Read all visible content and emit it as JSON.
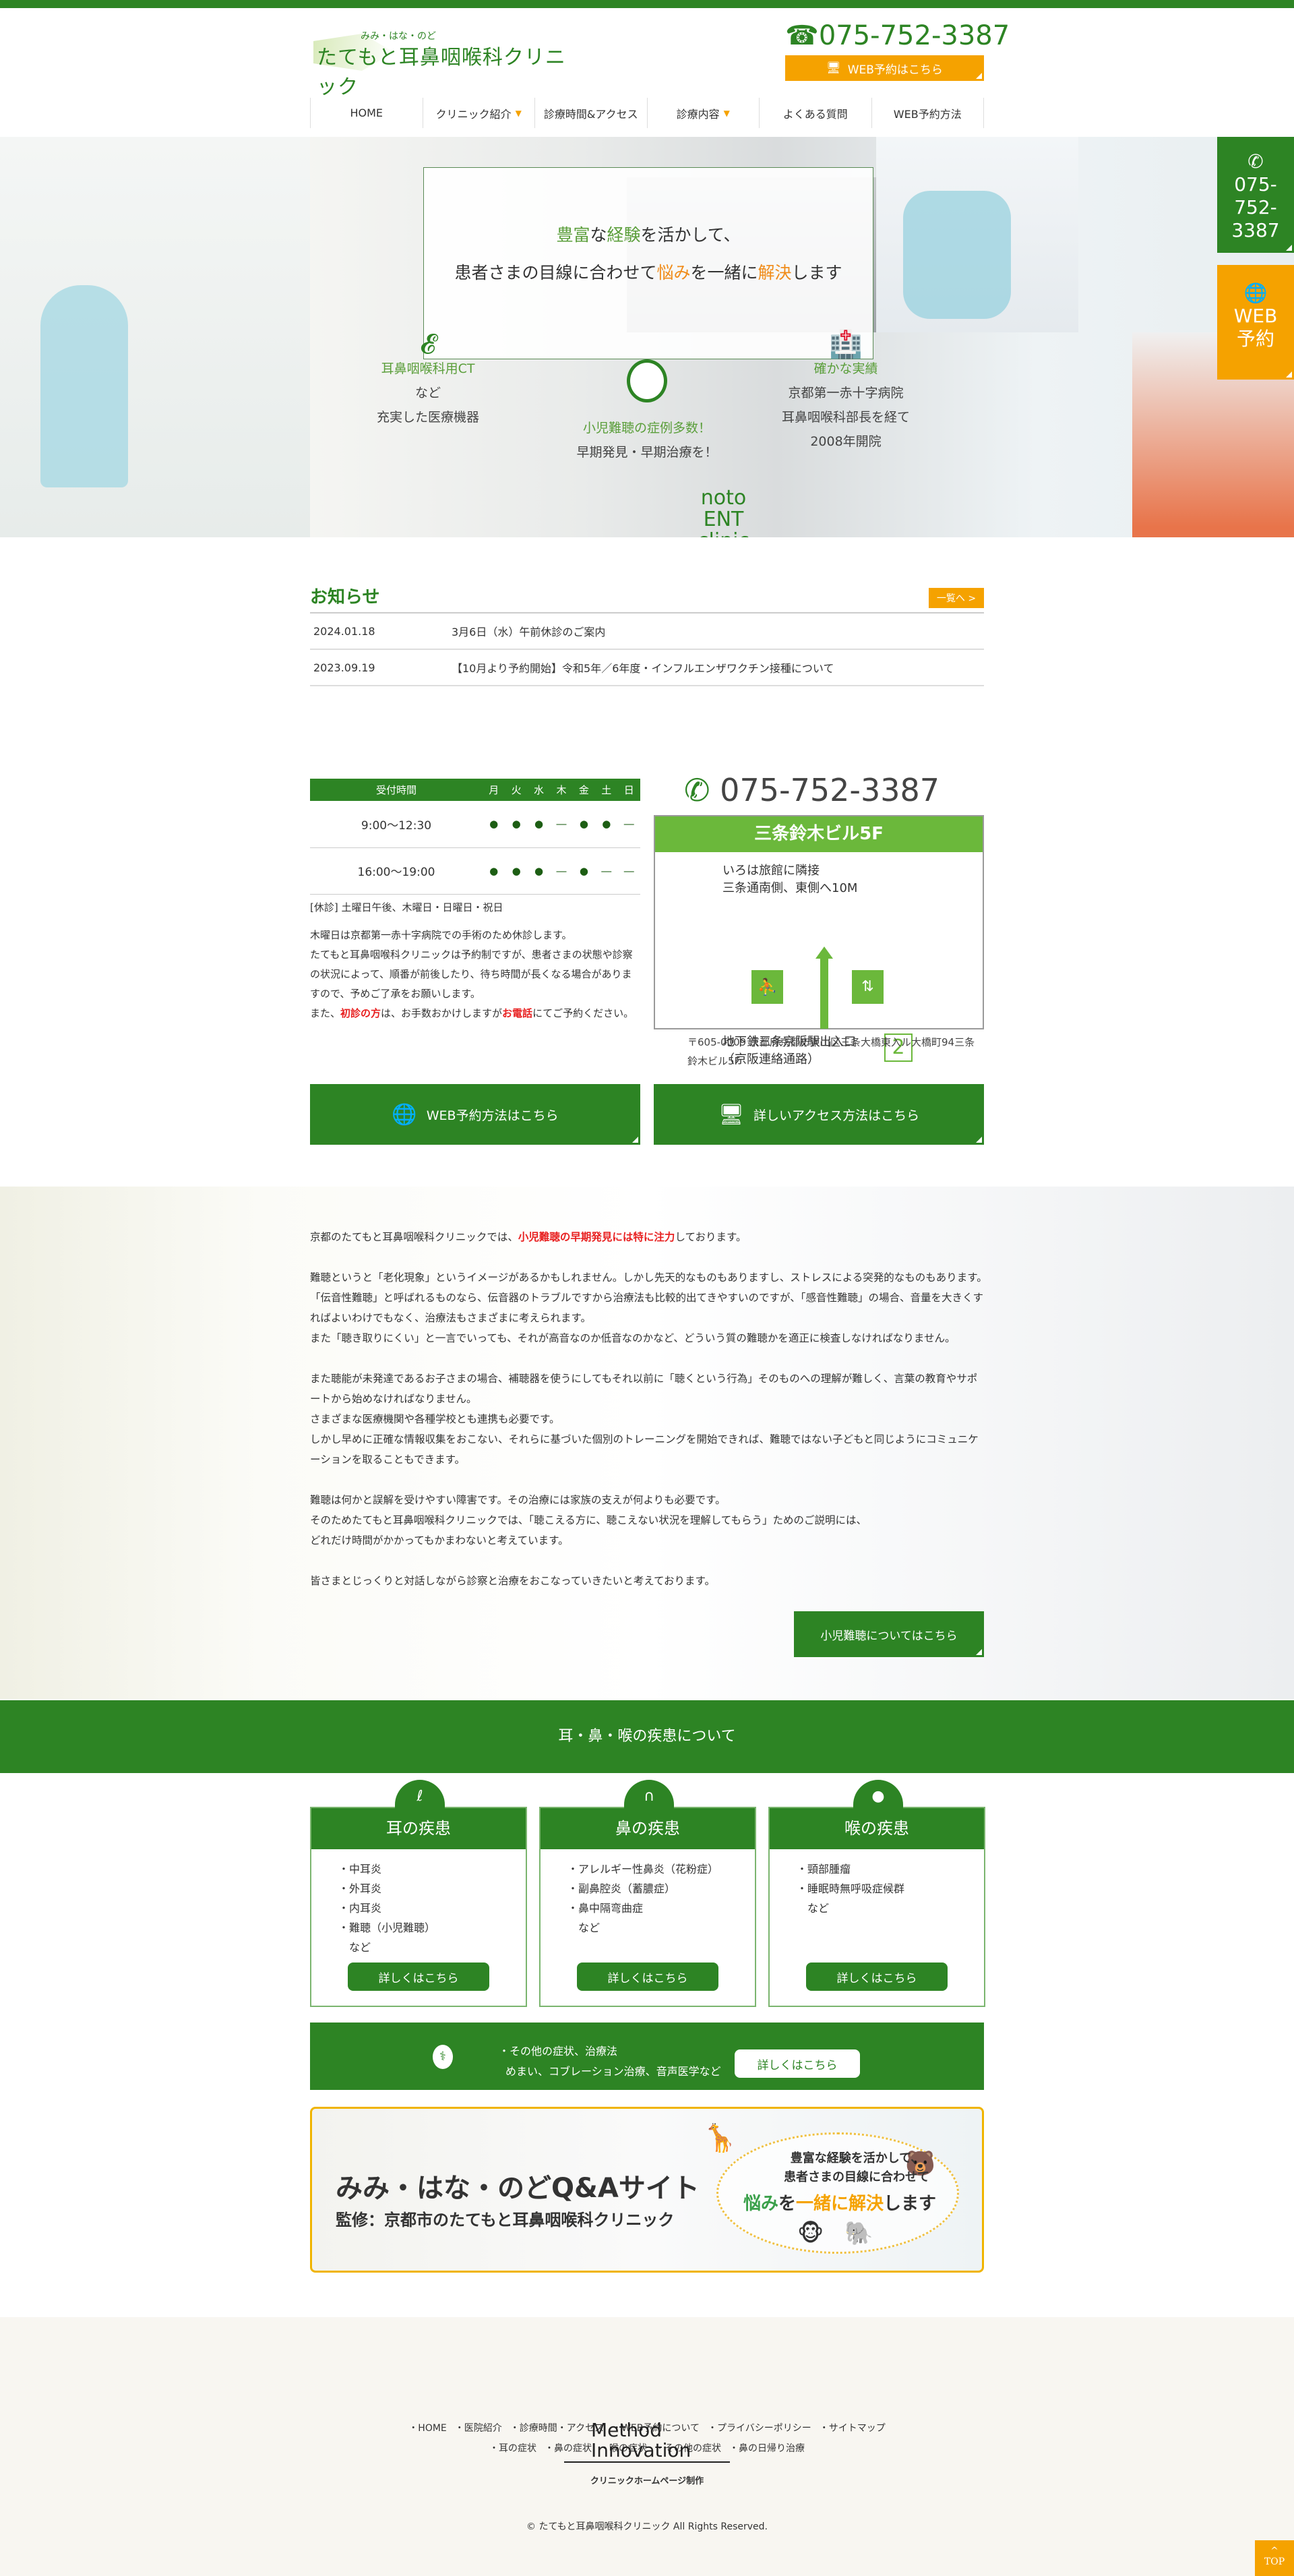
{
  "colors": {
    "primary": "#2d8424",
    "accent": "#f5a200",
    "light_green": "#6bb83b",
    "highlight": "#e82020"
  },
  "header": {
    "logo_sub": "みみ・はな・のど",
    "logo_main": "たてもと耳鼻咽喉科クリニック",
    "phone": "075-752-3387",
    "web_button": "WEB予約はこちら",
    "phone_icon": "phone-icon",
    "monitor_icon": "monitor-icon"
  },
  "nav": [
    {
      "label": "HOME"
    },
    {
      "label": "クリニック紹介",
      "dropdown": true
    },
    {
      "label": "診療時間&アクセス"
    },
    {
      "label": "診療内容",
      "dropdown": true
    },
    {
      "label": "よくある質問"
    },
    {
      "label": "WEB予約方法"
    }
  ],
  "hero": {
    "line1_a": "豊富",
    "line1_b": "な",
    "line1_c": "経験",
    "line1_d": "を活かして、",
    "line2_a": "患者さまの目線に合わせて",
    "line2_b": "悩み",
    "line2_c": "を一緒に",
    "line2_d": "解決",
    "line2_e": "します",
    "features": [
      {
        "icon": "ear-icon",
        "title": "耳鼻咽喉科用CT",
        "lines": [
          "など",
          "充実した医療機器"
        ]
      },
      {
        "icon": "child-face-icon",
        "title": "小児難聴の症例多数！",
        "lines": [
          "早期発見・早期治療を！"
        ]
      },
      {
        "icon": "hospital-icon",
        "title": "確かな実績",
        "lines": [
          "京都第一赤十字病院",
          "耳鼻咽喉科部長を経て",
          "2008年開院"
        ]
      }
    ],
    "watermark": [
      "Tatemoto",
      "ENT",
      "clinic"
    ]
  },
  "side_tabs": {
    "phone": "075-752-3387",
    "phone_lines": [
      "075-",
      "752-",
      "3387"
    ],
    "web_lines": [
      "WEB",
      "予約"
    ]
  },
  "news": {
    "title": "お知らせ",
    "more": "一覧へ >",
    "items": [
      {
        "date": "2024.01.18",
        "text": "3月6日（水）午前休診のご案内"
      },
      {
        "date": "2023.09.19",
        "text": "【10月より予約開始】令和5年／6年度・インフルエンザワクチン接種について"
      }
    ]
  },
  "hours": {
    "headers": [
      "受付時間",
      "月",
      "火",
      "水",
      "木",
      "金",
      "土",
      "日"
    ],
    "rows": [
      {
        "time": "9:00〜12:30",
        "cells": [
          "●",
          "●",
          "●",
          "―",
          "●",
          "●",
          "―"
        ]
      },
      {
        "time": "16:00〜19:00",
        "cells": [
          "●",
          "●",
          "●",
          "―",
          "●",
          "―",
          "―"
        ]
      }
    ],
    "closed": "[休診] 土曜日午後、木曜日・日曜日・祝日",
    "note1": "木曜日は京都第一赤十字病院での手術のため休診します。",
    "note2": "たてもと耳鼻咽喉科クリニックは予約制ですが、患者さまの状態や診察の状況によって、順番が前後したり、待ち時間が長くなる場合がありますので、予めご了承をお願いします。",
    "note3_a": "また、",
    "note3_b": "初診の方",
    "note3_c": "は、お手数おかけしますが",
    "note3_d": "お電話",
    "note3_e": "にてご予約ください。"
  },
  "access": {
    "phone": "075-752-3387",
    "building": "三条鈴木ビル5F",
    "dir1": "いろは旅館に隣接",
    "dir2": "三条通南側、東側へ10M",
    "station1": "地下鉄三条京阪駅出入口",
    "station2": "（京阪連絡通路）",
    "exit_no": "2",
    "address": "〒605-0009 京都府京都市東山区三条大橋東入ル大橋町94三条鈴木ビル5F"
  },
  "buttons": {
    "web": "WEB予約方法はこちら",
    "access": "詳しいアクセス方法はこちら"
  },
  "about": {
    "p1_a": "京都のたてもと耳鼻咽喉科クリニックでは、",
    "p1_b": "小児難聴の早期発見には特に注力",
    "p1_c": "しております。",
    "p2": [
      "難聴というと「老化現象」というイメージがあるかもしれません。しかし先天的なものもありますし、ストレスによる突発的なものもあります。",
      "「伝音性難聴」と呼ばれるものなら、伝音器のトラブルですから治療法も比較的出てきやすいのですが、「感音性難聴」の場合、音量を大きくすればよいわけでもなく、治療法もさまざまに考えられます。",
      "また「聴き取りにくい」と一言でいっても、それが高音なのか低音なのかなど、どういう質の難聴かを適正に検査しなければなりません。"
    ],
    "p3": [
      "また聴能が未発達であるお子さまの場合、補聴器を使うにしてもそれ以前に「聴くという行為」そのものへの理解が難しく、言葉の教育やサポートから始めなければなりません。",
      "さまざまな医療機関や各種学校とも連携も必要です。",
      "しかし早めに正確な情報収集をおこない、それらに基づいた個別のトレーニングを開始できれば、難聴ではない子どもと同じようにコミュニケーションを取ることもできます。"
    ],
    "p4": [
      "難聴は何かと誤解を受けやすい障害です。その治療には家族の支えが何よりも必要です。",
      "そのためたてもと耳鼻咽喉科クリニックでは、「聴こえる方に、聴こえない状況を理解してもらう」ためのご説明には、",
      "どれだけ時間がかかってもかまわないと考えています。"
    ],
    "p5": "皆さまとじっくりと対話しながら診察と治療をおこなっていきたいと考えております。",
    "button": "小児難聴についてはこちら"
  },
  "diseases": {
    "title": "耳・鼻・喉の疾患について",
    "cards": [
      {
        "icon": "ear-icon",
        "title": "耳の疾患",
        "items": [
          "・中耳炎",
          "・外耳炎",
          "・内耳炎",
          "・難聴（小児難聴）",
          "　など"
        ],
        "button": "詳しくはこちら"
      },
      {
        "icon": "nose-icon",
        "title": "鼻の疾患",
        "items": [
          "・アレルギー性鼻炎（花粉症）",
          "・副鼻腔炎（蓄膿症）",
          "・鼻中隔弯曲症",
          "　など"
        ],
        "button": "詳しくはこちら"
      },
      {
        "icon": "throat-icon",
        "title": "喉の疾患",
        "items": [
          "・頸部腫瘤",
          "・睡眠時無呼吸症候群",
          "　など"
        ],
        "button": "詳しくはこちら"
      }
    ],
    "other_line1": "・その他の症状、治療法",
    "other_line2": "めまい、コブレーション治療、音声医学など",
    "other_button": "詳しくはこちら"
  },
  "qa_banner": {
    "title": "みみ・はな・のどQ&Aサイト",
    "subtitle": "監修：京都市のたてもと耳鼻咽喉科クリニック",
    "bubble1": "豊富な経験を活かして、",
    "bubble2": "患者さまの目線に合わせて",
    "bubble3_a": "悩み",
    "bubble3_b": "を",
    "bubble3_c": "一緒に解決",
    "bubble3_d": "します"
  },
  "footer": {
    "links1": [
      "・HOME",
      "・医院紹介",
      "・診療時間・アクセス",
      "・WEB予約について",
      "・プライバシーポリシー",
      "・サイトマップ"
    ],
    "links2": [
      "・耳の症状",
      "・鼻の症状",
      "・喉の症状",
      "・その他の症状",
      "・鼻の日帰り治療"
    ],
    "maker_logo": "Method Innovation",
    "maker_caption": "クリニックホームページ制作",
    "copyright": "© たてもと耳鼻咽喉科クリニック All Rights Reserved.",
    "top": "TOP"
  }
}
